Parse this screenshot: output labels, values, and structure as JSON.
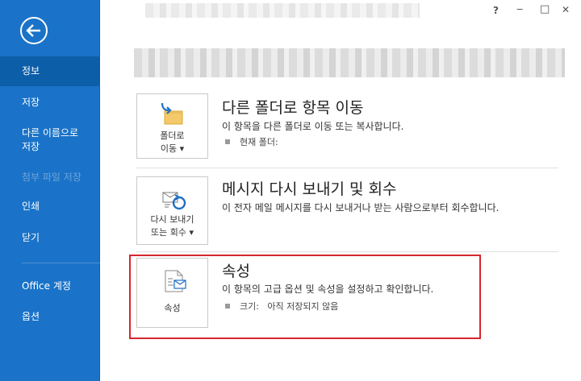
{
  "sidebar": {
    "back_icon": "back-arrow-icon",
    "items": [
      {
        "label": "정보",
        "state": "active"
      },
      {
        "label": "저장",
        "state": "normal"
      },
      {
        "label": "다른 이름으로 저장",
        "state": "normal"
      },
      {
        "label": "첨부 파일 저장",
        "state": "disabled"
      },
      {
        "label": "인쇄",
        "state": "normal"
      },
      {
        "label": "닫기",
        "state": "normal"
      },
      {
        "label": "Office 계정",
        "state": "normal"
      },
      {
        "label": "옵션",
        "state": "normal"
      }
    ],
    "colors": {
      "background": "#1a73c8",
      "active": "#0c5ea8"
    }
  },
  "window_controls": {
    "help": "?",
    "minimize": "‒",
    "maximize": "□",
    "close": "✕"
  },
  "sections": [
    {
      "title": "다른 폴더로 항목 이동",
      "description": "이 항목을 다른 폴더로 이동 또는 복사합니다.",
      "detail": "현재 폴더:",
      "button": {
        "line1": "폴더로",
        "line2": "이동 ▾",
        "icon": "folder-move-icon"
      }
    },
    {
      "title": "메시지 다시 보내기 및 회수",
      "description": "이 전자 메일 메시지를 다시 보내거나 받는 사람으로부터 회수합니다.",
      "button": {
        "line1": "다시 보내기",
        "line2": "또는 회수 ▾",
        "icon": "resend-recall-icon"
      }
    },
    {
      "title": "속성",
      "description": "이 항목의 고급 옵션 및 속성을 설정하고 확인합니다.",
      "detail": "크기:   아직 저장되지 않음",
      "button": {
        "line1": "속성",
        "icon": "properties-icon"
      }
    }
  ],
  "highlight_color": "#d7262e"
}
